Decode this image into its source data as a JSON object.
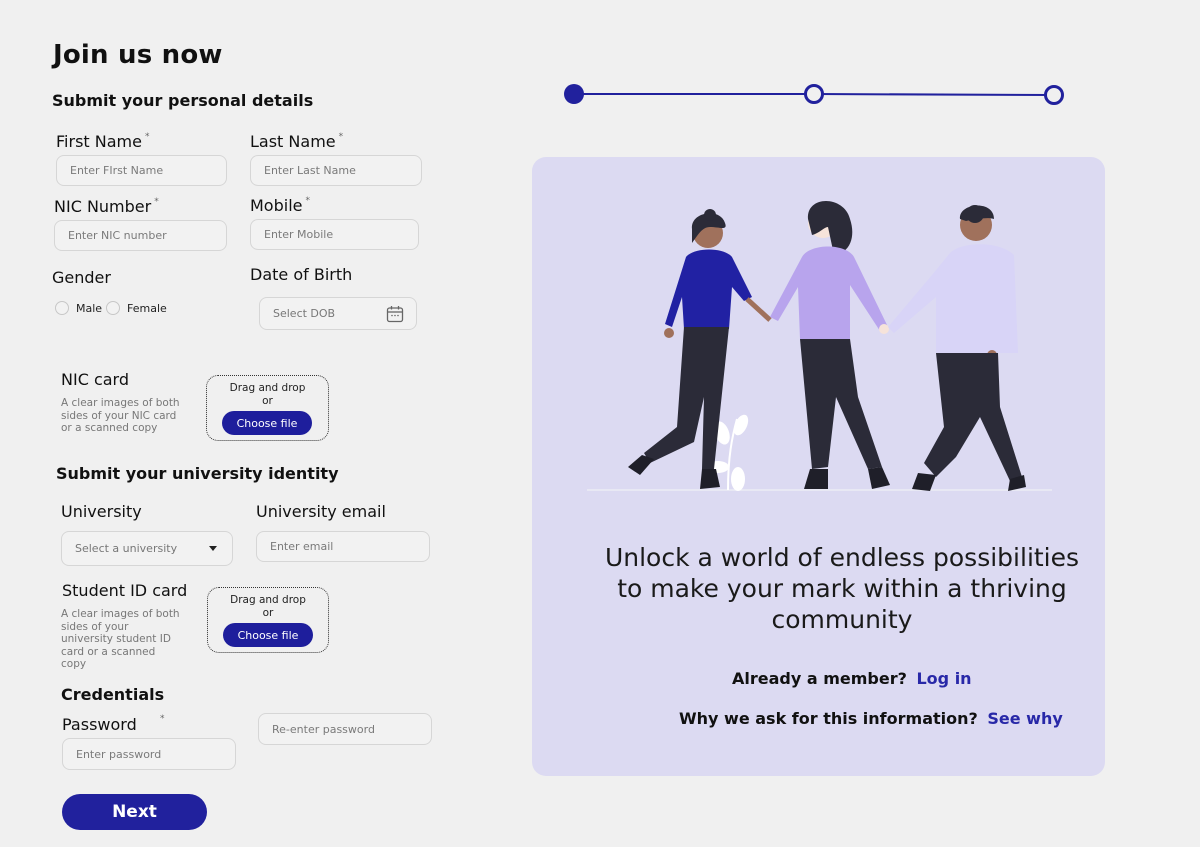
{
  "page": {
    "title": "Join us now",
    "personal_section": "Submit your personal details",
    "university_section": "Submit your university identity",
    "credentials_section": "Credentials"
  },
  "fields": {
    "first_name": {
      "label": "First Name",
      "placeholder": "Enter FIrst Name",
      "required": "*"
    },
    "last_name": {
      "label": "Last Name",
      "placeholder": "Enter Last Name",
      "required": "*"
    },
    "nic_number": {
      "label": "NIC Number",
      "placeholder": "Enter NIC number",
      "required": "*"
    },
    "mobile": {
      "label": "Mobile",
      "placeholder": "Enter Mobile",
      "required": "*"
    },
    "gender": {
      "label": "Gender",
      "options": [
        "Male",
        "Female"
      ]
    },
    "dob": {
      "label": "Date of Birth",
      "placeholder": "Select DOB"
    },
    "nic_card": {
      "label": "NIC card",
      "hint": "A clear images of both sides of your NIC card or a scanned copy",
      "drop_text": "Drag and drop",
      "or_text": "or",
      "button": "Choose file"
    },
    "university": {
      "label": "University",
      "placeholder": "Select a university"
    },
    "university_email": {
      "label": "University email",
      "placeholder": "Enter email"
    },
    "student_id": {
      "label": "Student ID card",
      "hint": "A clear images of both sides of your university student ID card or a scanned copy",
      "drop_text": "Drag and drop",
      "or_text": "or",
      "button": "Choose file"
    },
    "password": {
      "label": "Password",
      "placeholder": "Enter password",
      "required": "*"
    },
    "reenter_password": {
      "placeholder": "Re-enter password"
    }
  },
  "actions": {
    "next": "Next"
  },
  "stepper": {
    "steps": 3,
    "current": 1
  },
  "panel": {
    "tagline": "Unlock a world of endless possibilities to make your mark within a  thriving community",
    "member_text": "Already a member?",
    "login_link": "Log in",
    "why_text": "Why we ask for this information?",
    "why_link": "See why"
  },
  "colors": {
    "accent": "#21219d",
    "panel_bg": "#dcdaf2",
    "page_bg": "#f0f0f0"
  }
}
